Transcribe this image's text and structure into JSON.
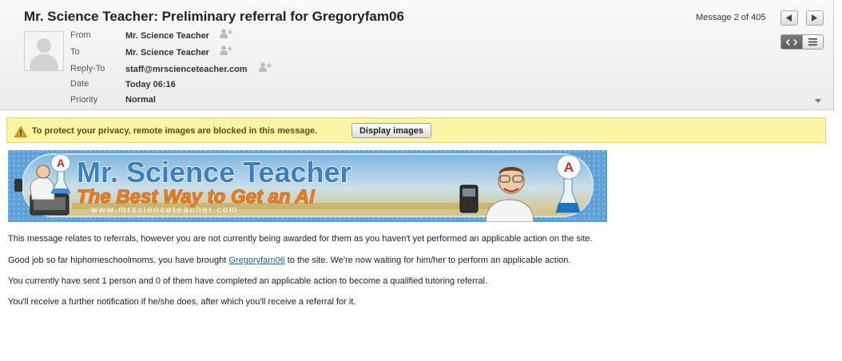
{
  "header": {
    "subject": "Mr. Science Teacher: Preliminary referral for Gregoryfam06",
    "message_counter": "Message 2 of 405",
    "fields": [
      {
        "label": "From",
        "value": "Mr. Science Teacher"
      },
      {
        "label": "To",
        "value": "Mr. Science Teacher"
      },
      {
        "label": "Reply-To",
        "value": "staff@mrscienceteacher.com"
      },
      {
        "label": "Date",
        "value": "Today 06:16"
      },
      {
        "label": "Priority",
        "value": "Normal"
      }
    ]
  },
  "banner": {
    "text": "To protect your privacy, remote images are blocked in this message.",
    "button_label": "Display images"
  },
  "logo": {
    "title": "Mr. Science Teacher",
    "tagline": "The Best Way to Get an A!",
    "url": "www.mrscienceteacher.com",
    "badge_letter": "A"
  },
  "body": {
    "line1": "This message relates to referrals, however you are not currently being awarded for them as you haven't yet performed an applicable action on the site.",
    "line2_prefix": "Good job so far hiphomeschoolmoms, you have brought ",
    "line2_link": "Gregoryfam06",
    "line2_suffix": " to the site. We're now waiting for him/her to perform an applicable action.",
    "line3": "You currently have sent 1 person and 0 of them have completed an applicable action to become a qualified tutoring referral.",
    "line4": "You'll receive a further notification if he/she does, after which you'll receive a referral for it."
  },
  "colors": {
    "banner_bg": "#fbf5a3",
    "link": "#1e5fa8",
    "logo_blue": "#2a74b8",
    "logo_orange": "#f07e1c"
  }
}
